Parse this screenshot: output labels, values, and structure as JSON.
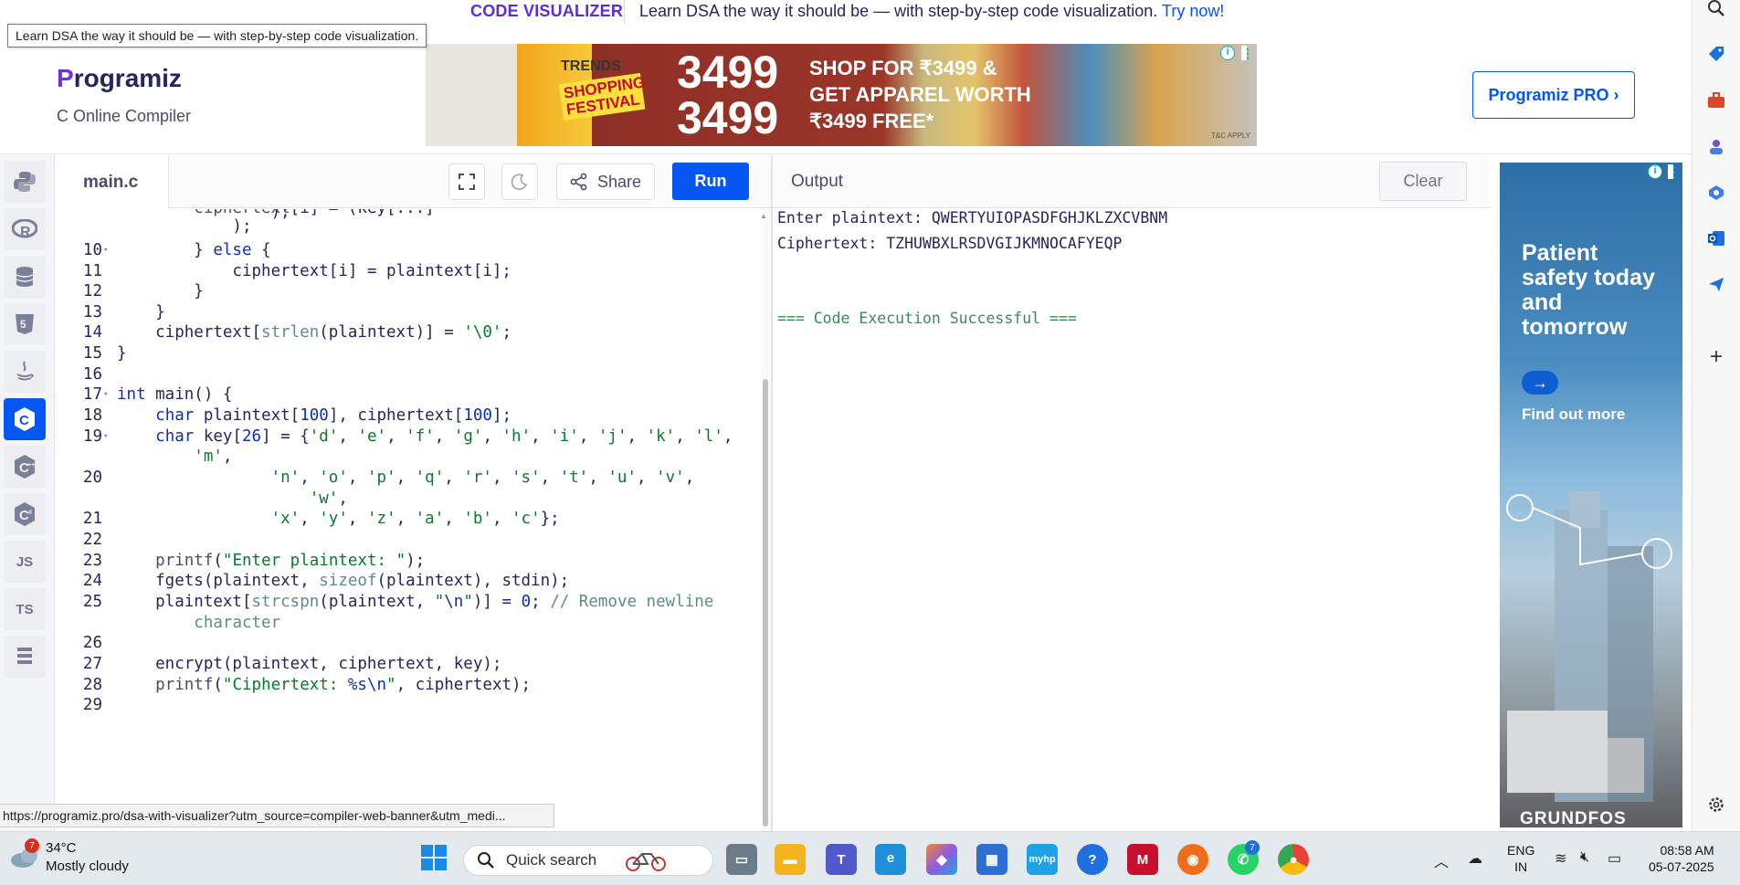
{
  "top_banner": {
    "brand": "CODE VISUALIZER",
    "message": "Learn DSA the way it should be — with step-by-step code visualization.",
    "link": "Try now!"
  },
  "tooltip": "Learn DSA the way it should be — with step-by-step code visualization.",
  "header": {
    "logo_p": "P",
    "logo_rest": "rogramiz",
    "subtitle": "C Online Compiler",
    "pro_button": "Programiz PRO ›"
  },
  "ad_banner": {
    "trends": "TRENDS",
    "festival": "SHOPPING FESTIVAL",
    "price": "3499",
    "offer": "SHOP FOR ₹3499 & GET APPAREL WORTH ₹3499 FREE*",
    "terms": "T&C APPLY"
  },
  "editor": {
    "file_tab": "main.c",
    "share_label": "Share",
    "run_label": "Run"
  },
  "code_lines": [
    {
      "n": "",
      "fold": false
    },
    {
      "n": "10",
      "fold": true
    },
    {
      "n": "11",
      "fold": false
    },
    {
      "n": "12",
      "fold": false
    },
    {
      "n": "13",
      "fold": false
    },
    {
      "n": "14",
      "fold": false
    },
    {
      "n": "15",
      "fold": false
    },
    {
      "n": "16",
      "fold": false
    },
    {
      "n": "17",
      "fold": true
    },
    {
      "n": "18",
      "fold": false
    },
    {
      "n": "19",
      "fold": true
    },
    {
      "n": "",
      "fold": false
    },
    {
      "n": "20",
      "fold": false
    },
    {
      "n": "",
      "fold": false
    },
    {
      "n": "21",
      "fold": false
    },
    {
      "n": "22",
      "fold": false
    },
    {
      "n": "23",
      "fold": false
    },
    {
      "n": "24",
      "fold": false
    },
    {
      "n": "25",
      "fold": false
    },
    {
      "n": "",
      "fold": false
    },
    {
      "n": "26",
      "fold": false
    },
    {
      "n": "27",
      "fold": false
    },
    {
      "n": "28",
      "fold": false
    },
    {
      "n": "29",
      "fold": false
    }
  ],
  "output": {
    "title": "Output",
    "clear_label": "Clear",
    "lines": [
      "Enter plaintext: QWERTYUIOPASDFGHJKLZXCVBNM",
      "Ciphertext: TZHUWBXLRSDVGIJKMNOCAFYEQP",
      "",
      "=== Code Execution Successful ==="
    ]
  },
  "side_ad": {
    "headline": "Patient safety today and tomorrow",
    "cta": "Find out more",
    "brand": "GRUNDFOS"
  },
  "status_url": "https://programiz.pro/dsa-with-visualizer?utm_source=compiler-web-banner&utm_medi...",
  "languages": [
    "python",
    "r",
    "sql",
    "html",
    "java",
    "c",
    "cpp",
    "csharp",
    "JS",
    "TS",
    "go"
  ],
  "taskbar": {
    "weather_temp": "34°C",
    "weather_desc": "Mostly cloudy",
    "weather_badge": "7",
    "search_placeholder": "Quick search",
    "lang_line1": "ENG",
    "lang_line2": "IN",
    "time": "08:58 AM",
    "date": "05-07-2025",
    "whatsapp_badge": "7"
  },
  "colors": {
    "accent": "#0556f3",
    "brand_purple": "#6b33e6",
    "text_dark": "#25265e"
  }
}
